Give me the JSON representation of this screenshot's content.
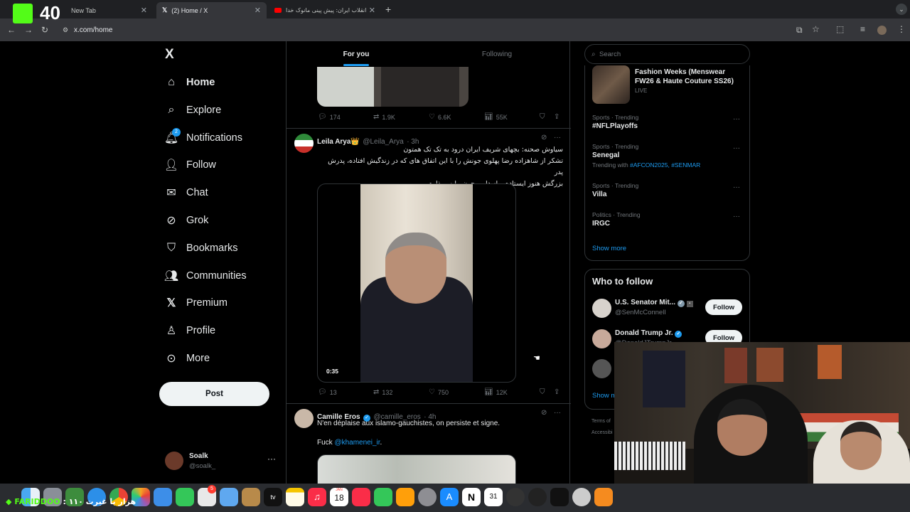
{
  "browser": {
    "tabs": [
      {
        "label": "New Tab",
        "active": false
      },
      {
        "label": "(2) Home / X",
        "active": true
      },
      {
        "label": "انقلاب ایران: پیش پینی مانوک خدا",
        "active": false
      }
    ],
    "url": "x.com/home",
    "overlay_badge": "40"
  },
  "sidebar": {
    "logo": "X",
    "items": [
      {
        "label": "Home",
        "icon": "home-icon"
      },
      {
        "label": "Explore",
        "icon": "search-icon"
      },
      {
        "label": "Notifications",
        "icon": "bell-icon",
        "badge": "2"
      },
      {
        "label": "Follow",
        "icon": "add-user-icon"
      },
      {
        "label": "Chat",
        "icon": "mail-icon"
      },
      {
        "label": "Grok",
        "icon": "grok-icon"
      },
      {
        "label": "Bookmarks",
        "icon": "bookmark-icon"
      },
      {
        "label": "Communities",
        "icon": "communities-icon"
      },
      {
        "label": "Premium",
        "icon": "x-icon"
      },
      {
        "label": "Profile",
        "icon": "person-icon"
      },
      {
        "label": "More",
        "icon": "more-circle-icon"
      }
    ],
    "post_label": "Post",
    "account": {
      "name": "Soalk",
      "handle": "@soalk_"
    }
  },
  "feed": {
    "tabs": [
      {
        "label": "For you",
        "active": true
      },
      {
        "label": "Following",
        "active": false
      }
    ],
    "posts": [
      {
        "stats": {
          "replies": "174",
          "reposts": "1.9K",
          "likes": "6.6K",
          "views": "55K"
        }
      },
      {
        "name": "Leila Arya👑",
        "handle": "@Leila_Arya",
        "time": "· 3h",
        "lines": [
          "سیاوش صحنه: بچهای شریف ایران درود به تک تک همتون",
          "تشکر از شاهزاده رضا پهلوی جونش را با این اتفاق های که در زندگیش افتاده، پدرش پدر",
          "بزرگش هنوز ایستاده و از دل و جون مایه میذاره"
        ],
        "video_duration": "0:35",
        "stats": {
          "replies": "13",
          "reposts": "132",
          "likes": "750",
          "views": "12K"
        }
      },
      {
        "name": "Camille Eros",
        "handle": "@camille_eros",
        "time": "· 4h",
        "text": "N'en déplaise aux islamo-gauchistes, on persiste et signe.",
        "text2_prefix": "Fuck ",
        "text2_mention": "@khamenei_ir",
        "text2_suffix": "."
      }
    ]
  },
  "right": {
    "search_placeholder": "Search",
    "live": {
      "title_line1": "Fashion Weeks (Menswear",
      "title_line2": "FW26 & Haute Couture SS26)",
      "status": "LIVE"
    },
    "trends": [
      {
        "meta": "Sports · Trending",
        "name": "#NFLPlayoffs"
      },
      {
        "meta": "Sports · Trending",
        "name": "Senegal",
        "with_prefix": "Trending with ",
        "with_tags": "#AFCON2025, #SENMAR"
      },
      {
        "meta": "Sports · Trending",
        "name": "Villa"
      },
      {
        "meta": "Politics · Trending",
        "name": "IRGC"
      }
    ],
    "show_more": "Show more",
    "who_to_follow": {
      "title": "Who to follow",
      "accounts": [
        {
          "name": "U.S. Senator Mit...",
          "handle": "@SenMcConnell",
          "button": "Follow"
        },
        {
          "name": "Donald Trump Jr.",
          "handle": "@DonaldJTrumpJr",
          "button": "Follow"
        }
      ],
      "show_more_partial": "Show m"
    },
    "footer_partial": [
      "Terms of",
      "Accessibi"
    ]
  },
  "dock": {
    "calendar_day": "18",
    "calendar_month": "JAN",
    "notes_badge": "5"
  },
  "overlay_text": {
    "label": "FARIDDOO",
    "rtl_text": "هزار با غیرت ۱۱۰ :"
  },
  "colors": {
    "accent": "#1d9bf0",
    "bg": "#000000",
    "border": "#2f3336",
    "muted": "#71767b",
    "verified": "#1d9bf0"
  }
}
